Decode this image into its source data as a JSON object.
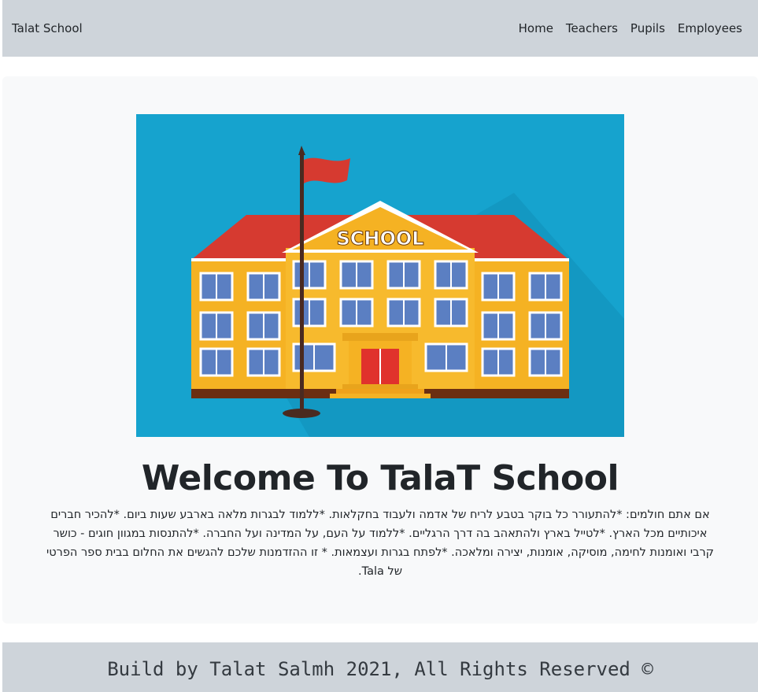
{
  "navbar": {
    "brand": "Talat School",
    "links": [
      "Home",
      "Teachers",
      "Pupils",
      "Employees"
    ]
  },
  "hero": {
    "image_label": "SCHOOL",
    "title": "Welcome To TalaT School",
    "description": "אם אתם חולמים: *להתעורר כל בוקר בטבע לריח של אדמה ולעבוד בחקלאות. *ללמוד לבגרות מלאה בארבע שעות ביום. *להכיר חברים איכותיים מכל הארץ. *לטייל בארץ ולהתאהב בה דרך הרגליים. *ללמוד על העם, על המדינה ועל החברה. *להתנסות במגוון חוגים - כושר קרבי ואומנות לחימה, מוסיקה, אומנות, יצירה ומלאכה. *לפתח בגרות ועצמאות. * זו ההזדמנות שלכם להגשים את החלום בבית ספר הפרטי של Tala."
  },
  "footer": {
    "text": "Build by Talat Salmh 2021, All Rights Reserved ©"
  },
  "colors": {
    "navbar_bg": "#ced4da",
    "jumbotron_bg": "#f8f9fa",
    "sky": "#16a3ce",
    "roof": "#d63a30",
    "building": "#f5b223",
    "door": "#e0322c",
    "window": "#5b7fc2"
  }
}
